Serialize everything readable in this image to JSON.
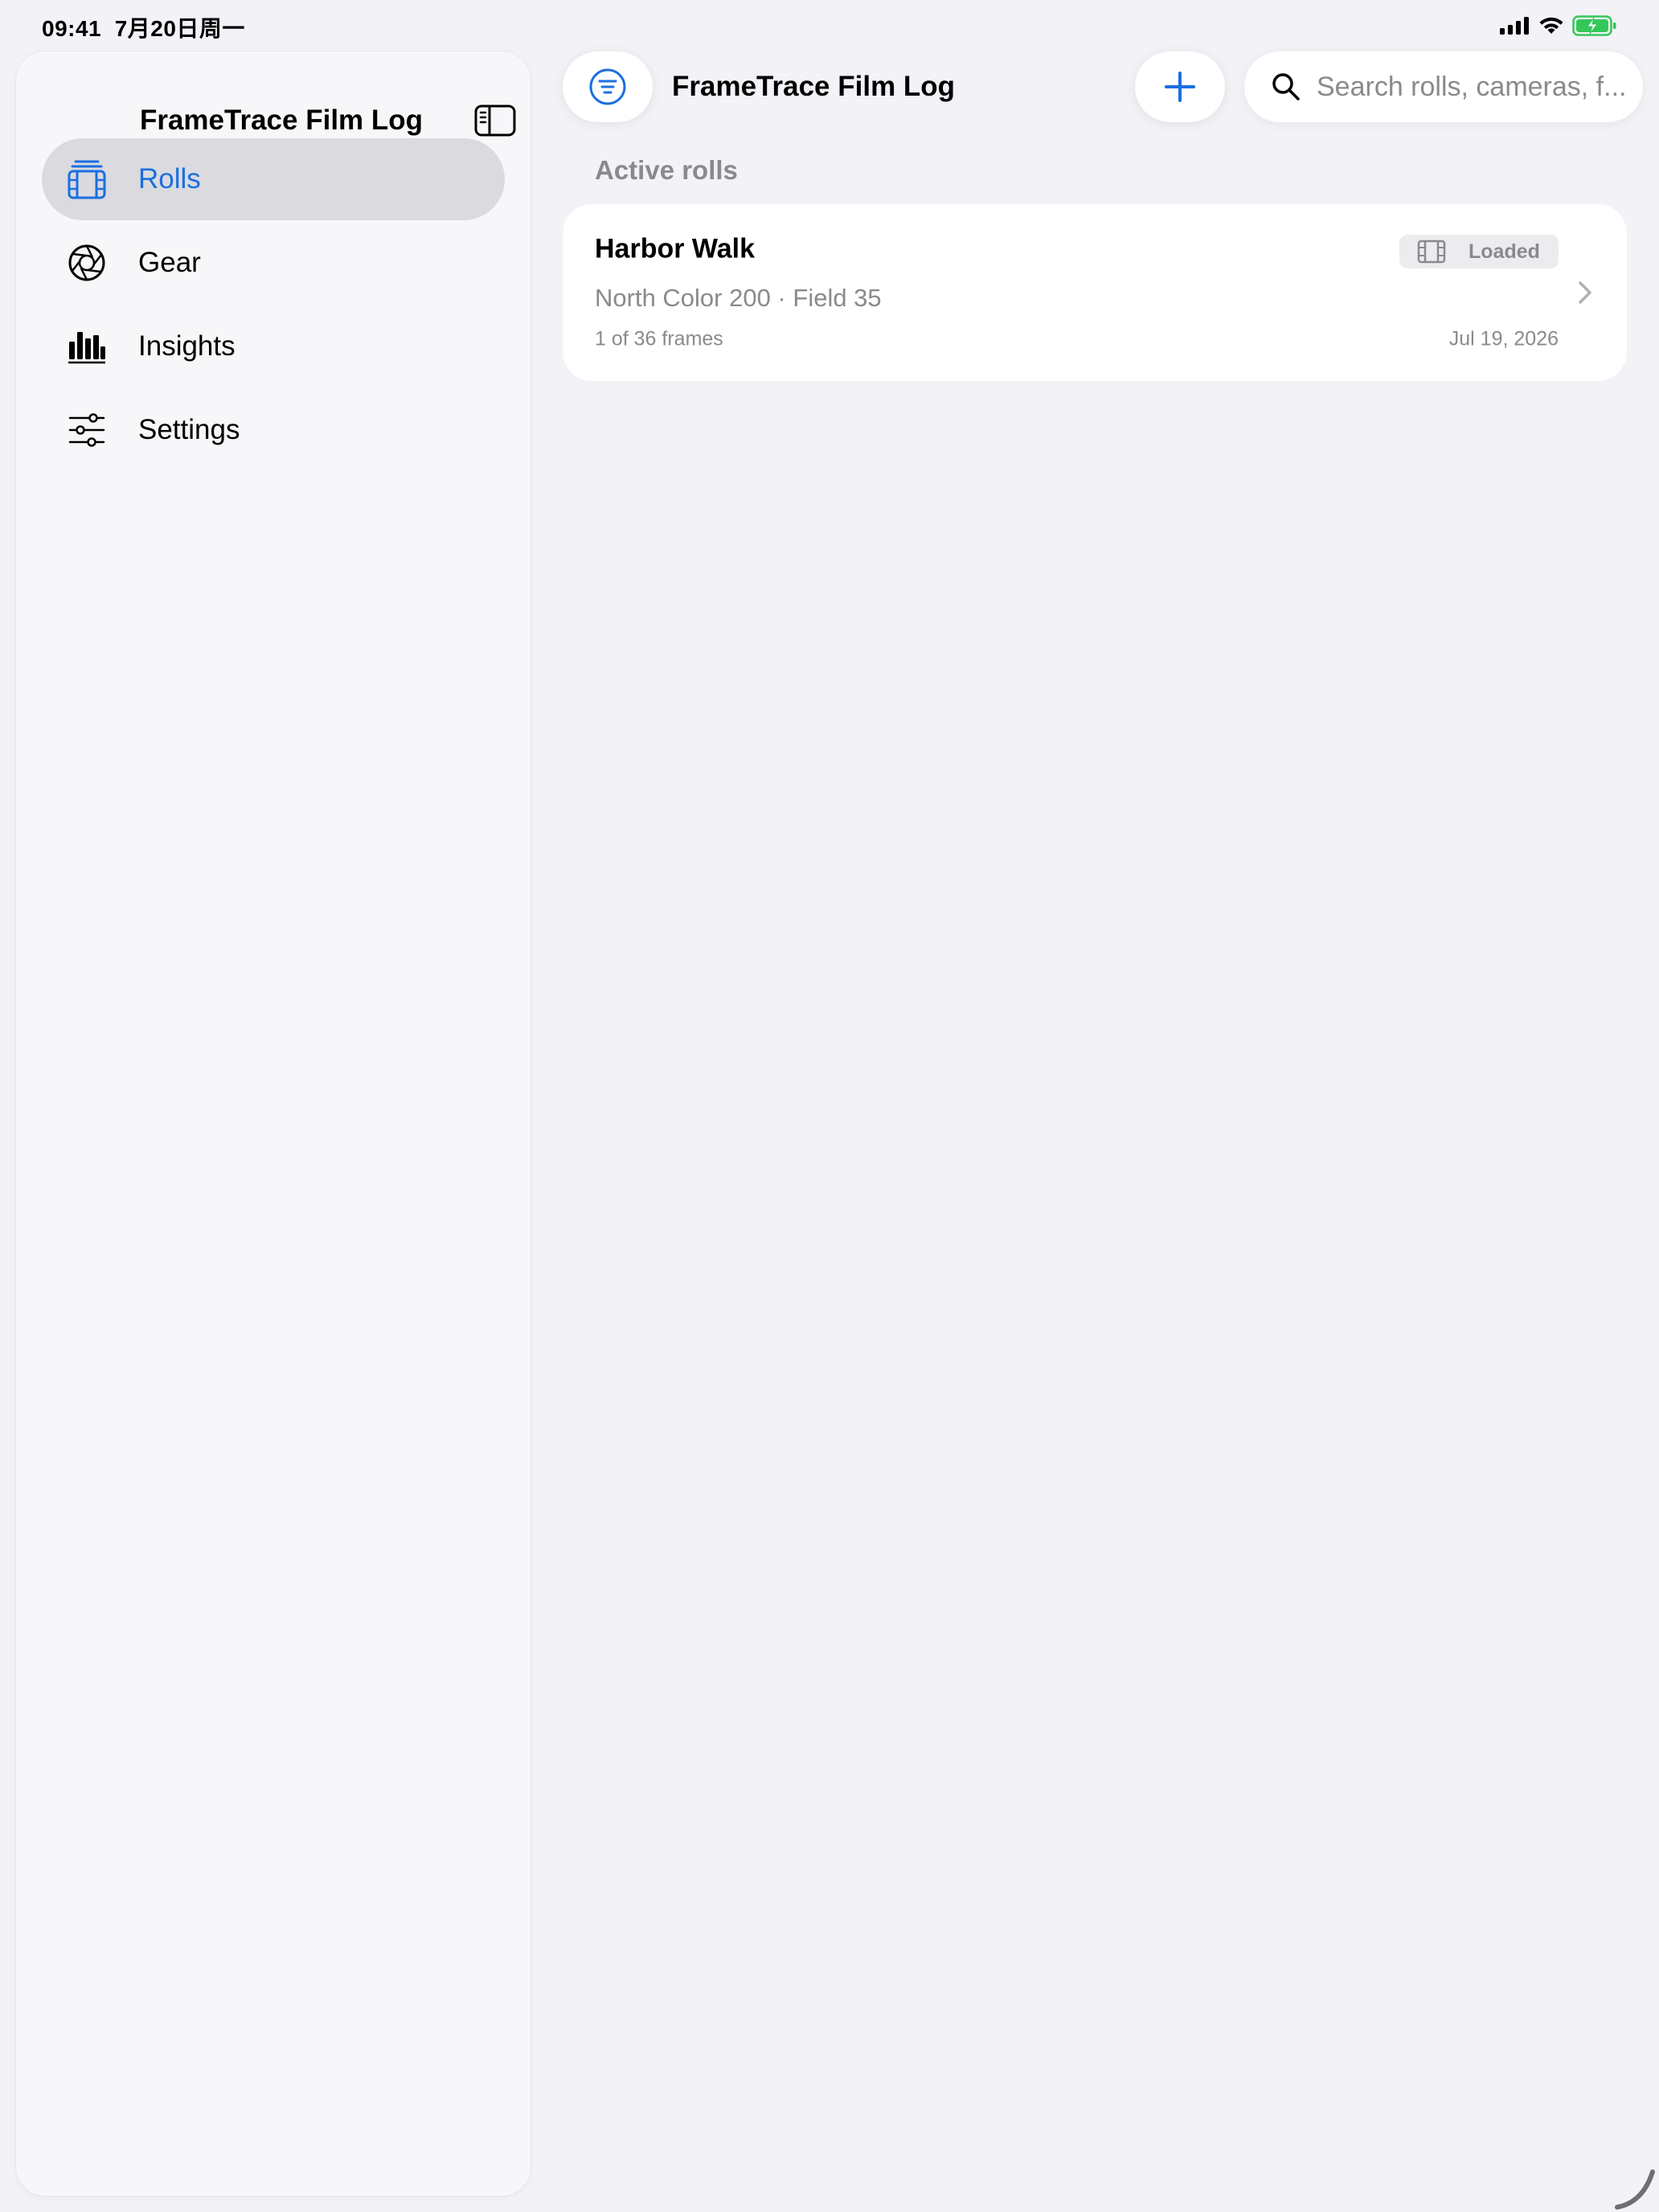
{
  "status_bar": {
    "time": "09:41",
    "date": "7月20日周一"
  },
  "sidebar": {
    "title": "FrameTrace Film Log",
    "items": [
      {
        "label": "Rolls",
        "icon": "film-roll-icon",
        "selected": true
      },
      {
        "label": "Gear",
        "icon": "aperture-icon",
        "selected": false
      },
      {
        "label": "Insights",
        "icon": "bar-chart-icon",
        "selected": false
      },
      {
        "label": "Settings",
        "icon": "sliders-icon",
        "selected": false
      }
    ]
  },
  "toolbar": {
    "title": "FrameTrace Film Log",
    "search_placeholder": "Search rolls, cameras, f..."
  },
  "main": {
    "section_header": "Active rolls",
    "rolls": [
      {
        "title": "Harbor Walk",
        "subtitle": "North Color 200 · Field 35",
        "frames": "1 of 36 frames",
        "date": "Jul 19, 2026",
        "status": "Loaded"
      }
    ]
  },
  "colors": {
    "accent": "#1a6fe0",
    "background": "#f2f2f7",
    "secondary_text": "#8a8a8e",
    "battery": "#34c759"
  }
}
